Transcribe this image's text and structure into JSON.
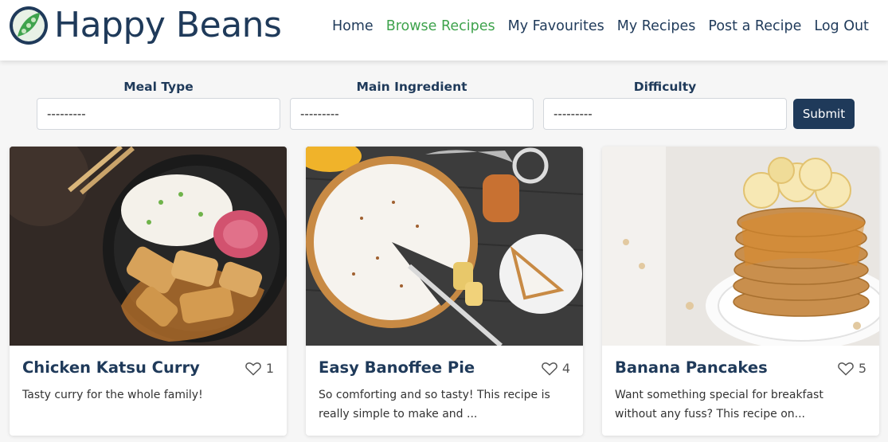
{
  "brand": {
    "name": "Happy Beans"
  },
  "nav": {
    "items": [
      {
        "label": "Home",
        "active": false
      },
      {
        "label": "Browse Recipes",
        "active": true
      },
      {
        "label": "My Favourites",
        "active": false
      },
      {
        "label": "My Recipes",
        "active": false
      },
      {
        "label": "Post a Recipe",
        "active": false
      },
      {
        "label": "Log Out",
        "active": false
      }
    ]
  },
  "filters": {
    "meal_type": {
      "label": "Meal Type",
      "value": "---------"
    },
    "main_ingredient": {
      "label": "Main Ingredient",
      "value": "---------"
    },
    "difficulty": {
      "label": "Difficulty",
      "value": "---------"
    },
    "submit_label": "Submit"
  },
  "recipes": [
    {
      "title": "Chicken Katsu Curry",
      "likes": "1",
      "description": "Tasty curry for the whole family!"
    },
    {
      "title": "Easy Banoffee Pie",
      "likes": "4",
      "description": "So comforting and so tasty! This recipe is really simple to make and ..."
    },
    {
      "title": "Banana Pancakes",
      "likes": "5",
      "description": "Want something special for breakfast without any fuss? This recipe on..."
    }
  ],
  "colors": {
    "primary": "#1f3a5a",
    "accent": "#3fa34d",
    "background": "#f6f6f6"
  }
}
